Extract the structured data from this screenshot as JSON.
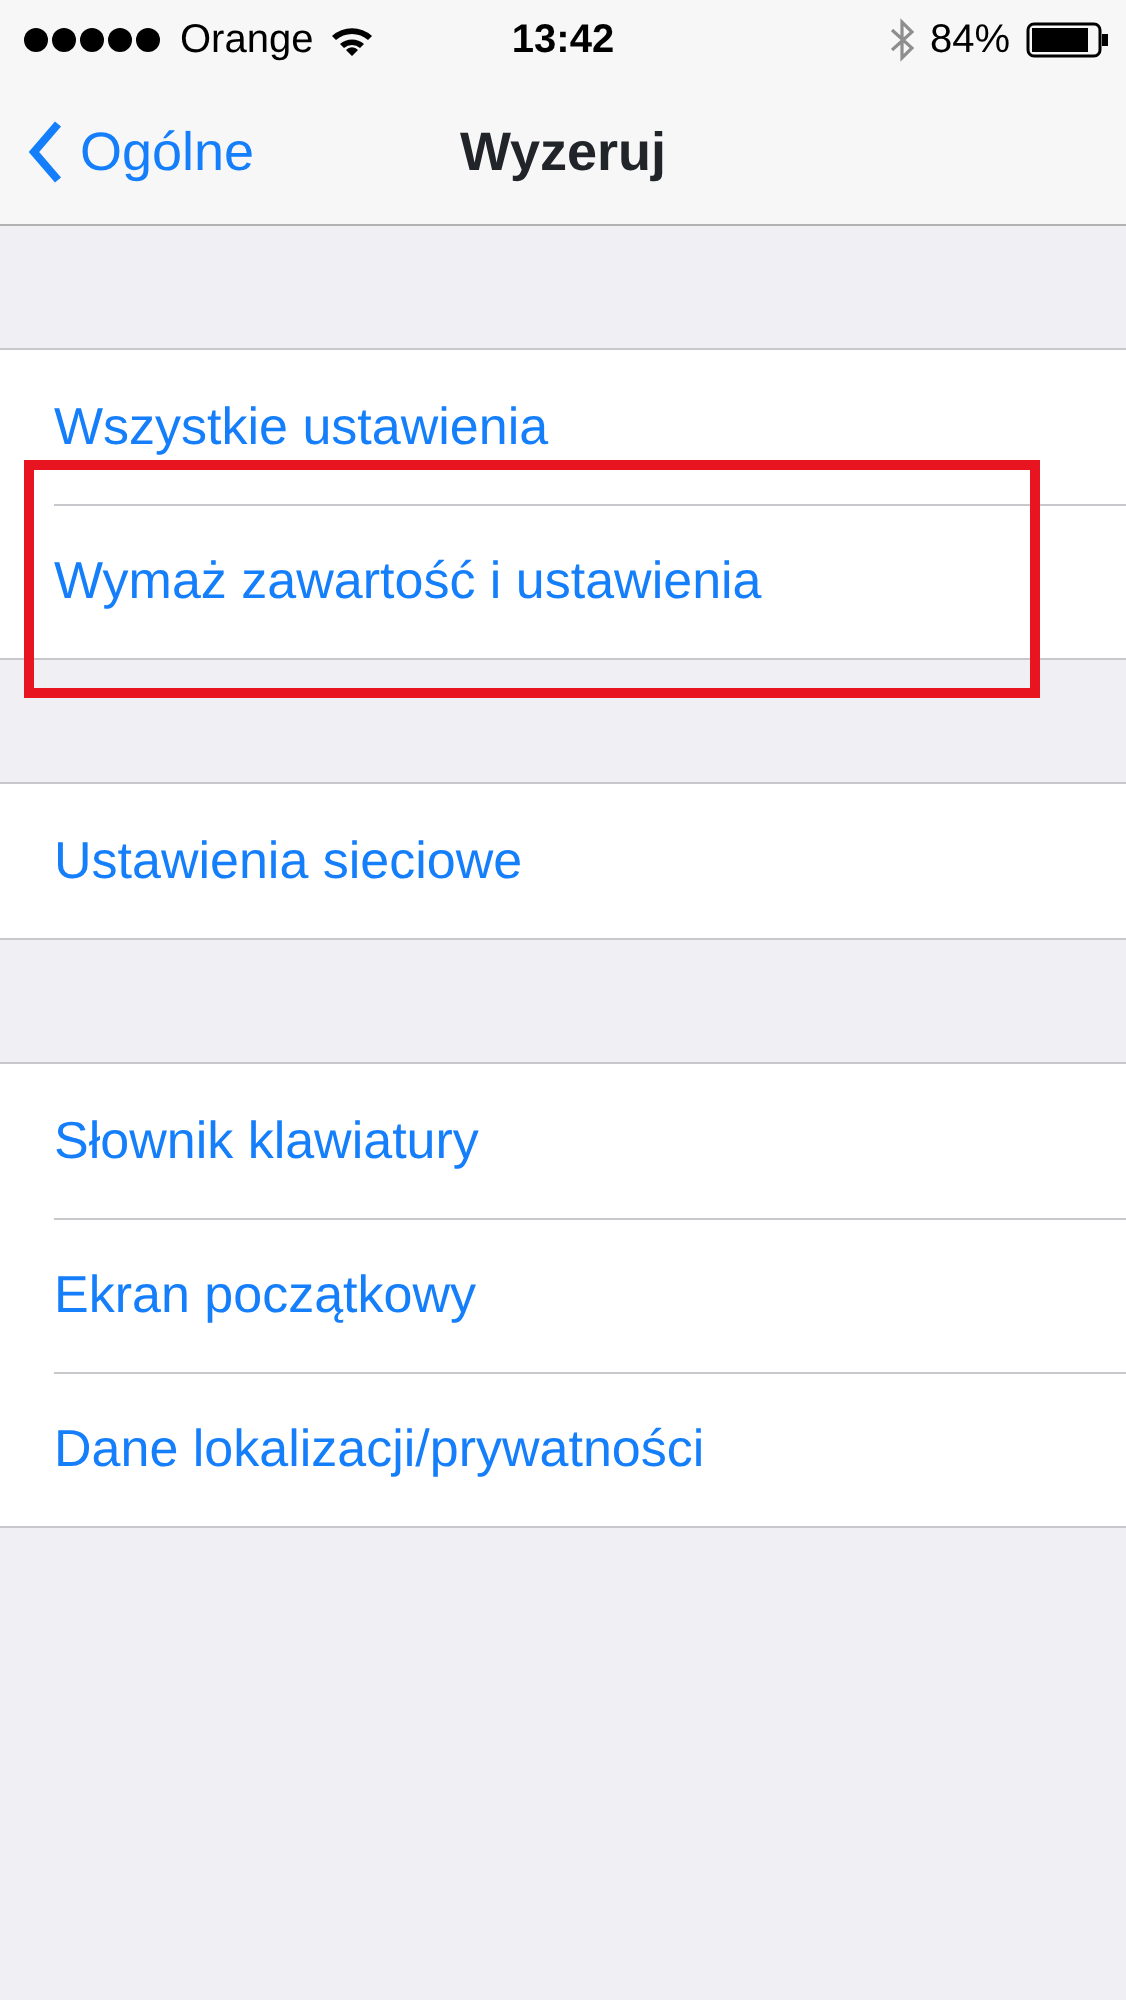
{
  "status_bar": {
    "carrier": "Orange",
    "time": "13:42",
    "battery": "84%"
  },
  "nav_bar": {
    "back": "Ogólne",
    "title": "Wyzeruj"
  },
  "groups": [
    {
      "items": [
        {
          "label": "Wszystkie ustawienia",
          "highlighted": false
        },
        {
          "label": "Wymaż zawartość i ustawienia",
          "highlighted": true
        }
      ]
    },
    {
      "items": [
        {
          "label": "Ustawienia sieciowe",
          "highlighted": false
        }
      ]
    },
    {
      "items": [
        {
          "label": "Słownik klawiatury",
          "highlighted": false
        },
        {
          "label": "Ekran początkowy",
          "highlighted": false
        },
        {
          "label": "Dane lokalizacji/prywatności",
          "highlighted": false
        }
      ]
    }
  ]
}
